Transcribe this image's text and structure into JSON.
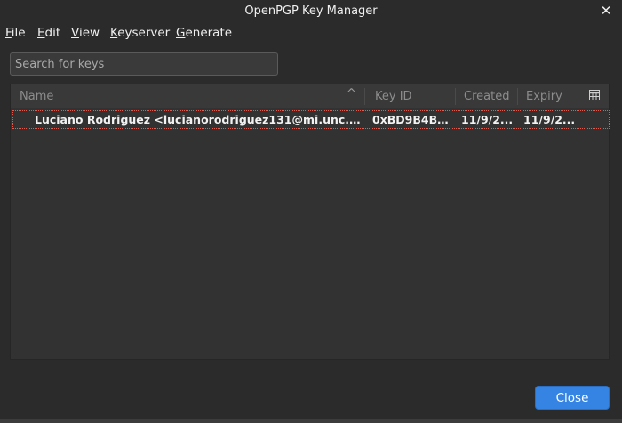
{
  "window": {
    "title": "OpenPGP Key Manager",
    "close_glyph": "✕"
  },
  "menubar": {
    "items": [
      {
        "accel": "F",
        "rest": "ile"
      },
      {
        "accel": "E",
        "rest": "dit"
      },
      {
        "accel": "V",
        "rest": "iew"
      },
      {
        "accel": "K",
        "rest": "eyserver"
      },
      {
        "accel": "G",
        "rest": "enerate"
      }
    ]
  },
  "search": {
    "placeholder": "Search for keys",
    "value": ""
  },
  "key_list": {
    "columns": [
      "Name",
      "Key ID",
      "Created",
      "Expiry"
    ],
    "sort_indicator": "^",
    "rows": [
      {
        "name": "Luciano Rodriguez <lucianorodriguez131@mi.unc.edu.ar...",
        "key_id": "0xBD9B4B0...",
        "created": "11/9/2...",
        "expiry": "11/9/2..."
      }
    ]
  },
  "footer": {
    "close_label": "Close"
  },
  "colors": {
    "background": "#2b2b2b",
    "accent": "#3584e4",
    "focus_outline": "#e05a4f"
  }
}
